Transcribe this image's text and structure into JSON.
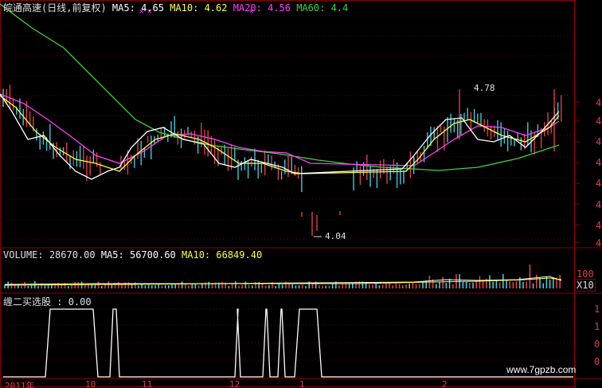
{
  "colors": {
    "background": "#000000",
    "grid": "#8b0000",
    "up": "#e04040",
    "down": "#40c8e0",
    "ma5": "#ffffff",
    "ma10": "#ffff40",
    "ma20": "#ff40ff",
    "ma60": "#40d040",
    "label": "#e0e0e0",
    "watermark": "#ffffff"
  },
  "price_panel": {
    "stock_name": "皖通高速(日线,前复权)",
    "ma5_label": "MA5:",
    "ma5_value": "4.65",
    "ma10_label": "MA10:",
    "ma10_value": "4.62",
    "ma20_label": "MA20:",
    "ma20_value": "4.56",
    "ma60_label": "MA60:",
    "ma60_value": "4.4",
    "high_marker": "4.78",
    "low_marker": "4.04",
    "y_tick_label": "4"
  },
  "volume_panel": {
    "label": "VOLUME:",
    "value": "28670.00",
    "ma5_label": "MA5:",
    "ma5_value": "56700.60",
    "ma10_label": "MA10:",
    "ma10_value": "66849.40",
    "scale_top": "100",
    "scale_mult": "X10"
  },
  "indicator_panel": {
    "label": "缠二买选股",
    "value": ": 0.00",
    "y_ticks": [
      "1",
      "1",
      "0",
      "0"
    ]
  },
  "x_axis": {
    "labels": [
      "2011年",
      "10",
      "11",
      "12",
      "1",
      "2"
    ]
  },
  "watermark": "www.7gpzb.com",
  "chart_data": {
    "type": "line",
    "title": "皖通高速(日线,前复权)",
    "series": [
      {
        "name": "MA5",
        "last": 4.65
      },
      {
        "name": "MA10",
        "last": 4.62
      },
      {
        "name": "MA20",
        "last": 4.56
      },
      {
        "name": "MA60",
        "last": 4.4
      }
    ],
    "annotations": {
      "high": 4.78,
      "low": 4.04
    },
    "volume": {
      "value": 28670.0,
      "ma5": 56700.6,
      "ma10": 66849.4
    },
    "signal": {
      "name": "缠二买选股",
      "value": 0.0,
      "ones_x_ranges": [
        [
          57,
          123
        ],
        [
          138,
          150
        ],
        [
          295,
          302
        ],
        [
          330,
          339
        ],
        [
          349,
          358
        ],
        [
          370,
          404
        ]
      ]
    },
    "ma60_curve": [
      [
        0,
        5
      ],
      [
        40,
        35
      ],
      [
        80,
        60
      ],
      [
        110,
        90
      ],
      [
        140,
        120
      ],
      [
        170,
        150
      ],
      [
        200,
        166
      ],
      [
        250,
        180
      ],
      [
        300,
        187
      ],
      [
        350,
        193
      ],
      [
        400,
        201
      ],
      [
        440,
        206
      ],
      [
        480,
        210
      ],
      [
        520,
        212
      ],
      [
        550,
        214
      ],
      [
        600,
        210
      ],
      [
        650,
        199
      ],
      [
        702,
        182
      ]
    ],
    "ma20_curve": [
      [
        0,
        118
      ],
      [
        30,
        130
      ],
      [
        60,
        150
      ],
      [
        90,
        172
      ],
      [
        120,
        195
      ],
      [
        150,
        205
      ],
      [
        180,
        190
      ],
      [
        210,
        170
      ],
      [
        240,
        168
      ],
      [
        270,
        175
      ],
      [
        300,
        185
      ],
      [
        330,
        190
      ],
      [
        360,
        192
      ],
      [
        390,
        205
      ],
      [
        520,
        208
      ],
      [
        540,
        195
      ],
      [
        570,
        175
      ],
      [
        600,
        158
      ],
      [
        630,
        160
      ],
      [
        660,
        170
      ],
      [
        690,
        160
      ],
      [
        702,
        152
      ]
    ],
    "ma10_curve": [
      [
        0,
        120
      ],
      [
        20,
        135
      ],
      [
        45,
        165
      ],
      [
        70,
        185
      ],
      [
        95,
        200
      ],
      [
        120,
        205
      ],
      [
        150,
        215
      ],
      [
        170,
        195
      ],
      [
        195,
        175
      ],
      [
        220,
        168
      ],
      [
        250,
        175
      ],
      [
        270,
        185
      ],
      [
        300,
        205
      ],
      [
        330,
        205
      ],
      [
        360,
        215
      ],
      [
        380,
        218
      ],
      [
        510,
        215
      ],
      [
        525,
        200
      ],
      [
        545,
        175
      ],
      [
        570,
        155
      ],
      [
        590,
        150
      ],
      [
        610,
        160
      ],
      [
        630,
        170
      ],
      [
        660,
        178
      ],
      [
        690,
        160
      ],
      [
        702,
        145
      ]
    ],
    "ma5_curve": [
      [
        0,
        118
      ],
      [
        15,
        140
      ],
      [
        35,
        175
      ],
      [
        55,
        170
      ],
      [
        75,
        195
      ],
      [
        95,
        215
      ],
      [
        115,
        225
      ],
      [
        135,
        215
      ],
      [
        150,
        210
      ],
      [
        165,
        185
      ],
      [
        185,
        165
      ],
      [
        205,
        160
      ],
      [
        230,
        175
      ],
      [
        255,
        180
      ],
      [
        275,
        205
      ],
      [
        295,
        210
      ],
      [
        315,
        200
      ],
      [
        335,
        205
      ],
      [
        355,
        210
      ],
      [
        370,
        218
      ],
      [
        505,
        212
      ],
      [
        520,
        195
      ],
      [
        540,
        170
      ],
      [
        560,
        150
      ],
      [
        580,
        148
      ],
      [
        600,
        175
      ],
      [
        620,
        178
      ],
      [
        640,
        170
      ],
      [
        660,
        185
      ],
      [
        680,
        165
      ],
      [
        702,
        140
      ]
    ]
  }
}
